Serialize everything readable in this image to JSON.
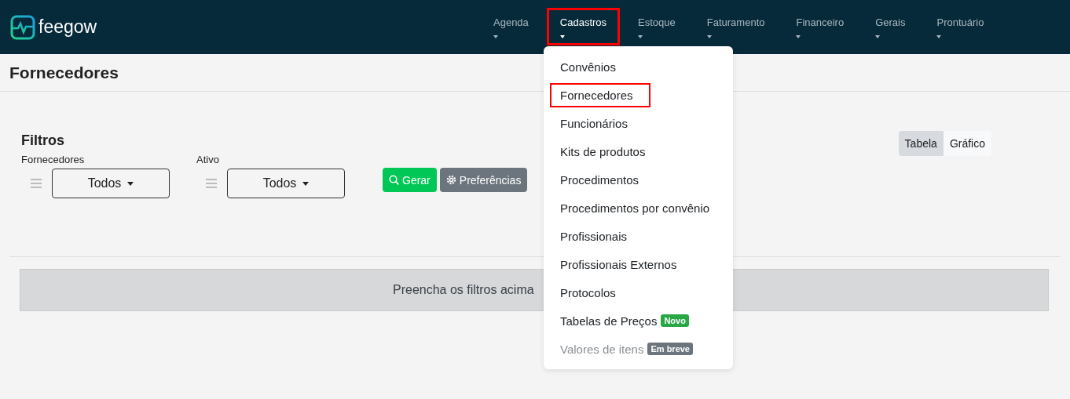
{
  "header": {
    "logo": "feegow",
    "nav": [
      {
        "label": "Agenda",
        "selected": false,
        "highlighted": false
      },
      {
        "label": "Cadastros",
        "selected": true,
        "highlighted": true
      },
      {
        "label": "Estoque",
        "selected": false,
        "highlighted": false
      },
      {
        "label": "Faturamento",
        "selected": false,
        "highlighted": false
      },
      {
        "label": "Financeiro",
        "selected": false,
        "highlighted": false
      },
      {
        "label": "Gerais",
        "selected": false,
        "highlighted": false
      },
      {
        "label": "Prontuário",
        "selected": false,
        "highlighted": false
      }
    ]
  },
  "dropdown": [
    {
      "label": "Convênios",
      "highlighted": false,
      "disabled": false
    },
    {
      "label": "Fornecedores",
      "highlighted": true,
      "disabled": false
    },
    {
      "label": "Funcionários",
      "highlighted": false,
      "disabled": false
    },
    {
      "label": "Kits de produtos",
      "highlighted": false,
      "disabled": false
    },
    {
      "label": "Procedimentos",
      "highlighted": false,
      "disabled": false
    },
    {
      "label": "Procedimentos por convênio",
      "highlighted": false,
      "disabled": false
    },
    {
      "label": "Profissionais",
      "highlighted": false,
      "disabled": false
    },
    {
      "label": "Profissionais Externos",
      "highlighted": false,
      "disabled": false
    },
    {
      "label": "Protocolos",
      "highlighted": false,
      "disabled": false
    },
    {
      "label": "Tabelas de Preços",
      "highlighted": false,
      "disabled": false,
      "badge": "Novo",
      "color": "#28a745"
    },
    {
      "label": "Valores de itens",
      "highlighted": false,
      "disabled": true,
      "badge": "Em breve",
      "color": "#6c757d"
    }
  ],
  "page_title": "Fornecedores",
  "filters": {
    "title": "Filtros",
    "fields": [
      {
        "label": "Fornecedores",
        "value": "Todos"
      },
      {
        "label": "Ativo",
        "value": "Todos"
      }
    ],
    "buttons": [
      {
        "kind": "primary",
        "label": "Gerar"
      },
      {
        "kind": "secondary",
        "label": "Preferências"
      }
    ]
  },
  "view_toggle": [
    {
      "label": "Tabela",
      "selected": true
    },
    {
      "label": "Gráfico",
      "selected": false
    }
  ],
  "message": "Preencha os filtros acima"
}
